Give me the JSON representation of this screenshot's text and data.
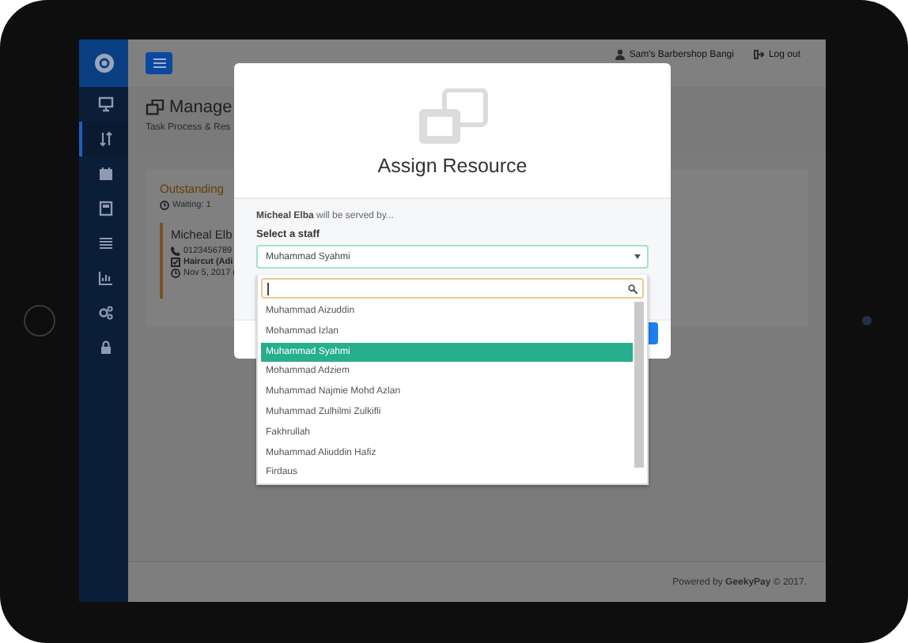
{
  "sidebar": {
    "items": [
      {
        "selected": false
      },
      {
        "selected": true
      },
      {
        "selected": false
      },
      {
        "selected": false
      },
      {
        "selected": false
      },
      {
        "selected": false
      },
      {
        "selected": false
      },
      {
        "selected": false
      }
    ]
  },
  "topbar": {
    "user": "Sam's Barbershop Bangi",
    "logout": "Log out"
  },
  "page_header": {
    "title": "Manage",
    "subtitle": "Task Process & Res"
  },
  "outstanding": {
    "title": "Outstanding",
    "waiting": "Waiting: 1",
    "customer": {
      "name": "Micheal Elb",
      "phone": "0123456789",
      "service": "Haircut (Adi",
      "date": "Nov 5, 2017 ("
    }
  },
  "footer": {
    "prefix": "Powered by ",
    "brand": "GeekyPay",
    "suffix": " © 2017."
  },
  "modal": {
    "title": "Assign Resource",
    "message": "**Micheal Elba** will be served by...",
    "select_label": "Select a staff",
    "selected_value": "Muhammad Syahmi",
    "options": [
      {
        "label": "Muhammad Aizuddin",
        "selected": false
      },
      {
        "label": "Mohammad Izlan",
        "selected": false
      },
      {
        "label": "Muhammad Syahmi",
        "selected": true
      },
      {
        "label": "Mohammad Adziem",
        "selected": false
      },
      {
        "label": "Muhammad Najmie Mohd Azlan",
        "selected": false
      },
      {
        "label": "Muhammad Zulhilmi Zulkifli",
        "selected": false
      },
      {
        "label": "Fakhrullah",
        "selected": false
      },
      {
        "label": "Muhammad Aliuddin Hafiz",
        "selected": false
      },
      {
        "label": "Firdaus",
        "selected": false
      }
    ]
  }
}
